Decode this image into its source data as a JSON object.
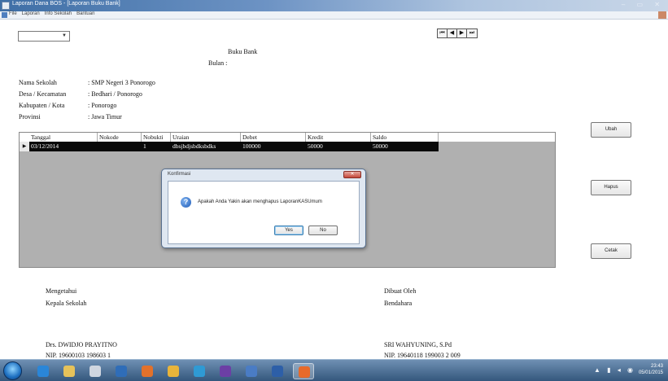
{
  "window": {
    "title": "Laporan Dana BOS - [Laporan Buku Bank]",
    "controls": "– ▭ ✕"
  },
  "menu": {
    "items": [
      "File",
      "Laporan",
      "Info Sekolah",
      "Bantuan"
    ]
  },
  "navigator": [
    "⏮",
    "◀",
    "▶",
    "⏭"
  ],
  "report": {
    "title": "Buku Bank",
    "bulan_label": "Bulan :"
  },
  "school_info": [
    {
      "label": "Nama Sekolah",
      "value": ": SMP Negeri 3 Ponorogo"
    },
    {
      "label": "Desa / Kecamatan",
      "value": ": Bedhari / Ponorogo"
    },
    {
      "label": "Kabupaten / Kota",
      "value": ": Ponorogo"
    },
    {
      "label": "Provinsi",
      "value": ": Jawa Timur"
    }
  ],
  "grid": {
    "columns": [
      "Tanggal",
      "Nokode",
      "Nobukti",
      "Uraian",
      "Debet",
      "Kredit",
      "Saldo"
    ],
    "rows": [
      [
        "03/12/2014",
        "",
        "1",
        "dbsjbdjsbdksbdks",
        "100000",
        "50000",
        "50000"
      ]
    ],
    "row_indicator": "▶"
  },
  "buttons": {
    "ubah": "Ubah",
    "hapus": "Hapus",
    "cetak": "Cetak"
  },
  "dialog": {
    "title": "Konfirmasi",
    "close": "✕",
    "message": "Apakah Anda Yakin akan menghapus LaporanKASUmum",
    "yes": "Yes",
    "no": "No",
    "icon": "?"
  },
  "signatures": {
    "left": {
      "line1": "Mengetahui",
      "line2": "Kepala Sekolah",
      "name": "Drs. DWIDJO PRAYITNO",
      "nip": "NIP. 19600103 198603 1"
    },
    "right": {
      "line1": "Dibuat Oleh",
      "line2": "Bendahara",
      "name": "SRI WAHYUNING, S.Pd",
      "nip": "NIP. 19640118 199003 2 009"
    }
  },
  "taskbar": {
    "icons": [
      {
        "name": "ie-icon",
        "color": "#2a86d8"
      },
      {
        "name": "explorer-icon",
        "color": "#e6c25a"
      },
      {
        "name": "vb-icon",
        "color": "#cfd6e0"
      },
      {
        "name": "outlook-icon",
        "color": "#2f6db8"
      },
      {
        "name": "firefox-icon",
        "color": "#e2712b"
      },
      {
        "name": "chrome-icon",
        "color": "#e9b43a"
      },
      {
        "name": "opera-icon",
        "color": "#2f9ad4"
      },
      {
        "name": "vs-icon",
        "color": "#6c3fa5"
      },
      {
        "name": "app-icon-blue",
        "color": "#4a7cc4"
      },
      {
        "name": "word-icon",
        "color": "#2d5fa8"
      },
      {
        "name": "app-icon-orange",
        "color": "#e86a2a"
      }
    ],
    "clock_time": "23:43",
    "clock_date": "05/01/2015",
    "tray": "▲ ▮ ◂ ◉"
  }
}
